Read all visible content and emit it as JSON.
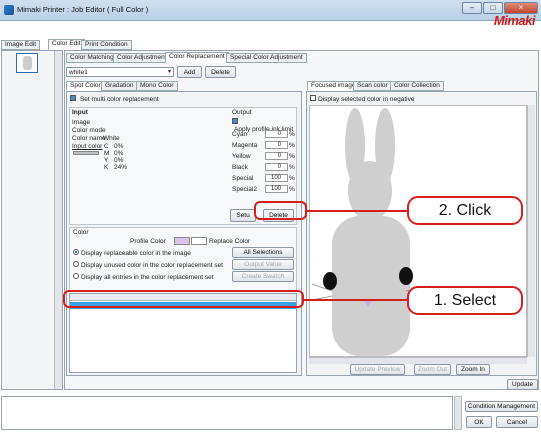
{
  "window": {
    "title": "Mimaki Printer : Job Editor ( Full Color )",
    "logo": "Mimaki",
    "min": "–",
    "max": "□",
    "close": "×"
  },
  "main_tabs": [
    "Image Edit",
    "Color Edit",
    "Print Condition"
  ],
  "color_tabs": [
    "Color Matching",
    "Color Adjustment",
    "Color Replacement",
    "Special Color Adjustment"
  ],
  "preset": {
    "value": "white1",
    "add": "Add",
    "delete": "Delete"
  },
  "sub_tabs": [
    "Spot Color",
    "Gradation",
    "Mono Color"
  ],
  "multi_replace": "Set multi color replacement",
  "input": {
    "heading": "Input",
    "image": "Image",
    "mode": "Color mode",
    "name_label": "Color name",
    "name": "White",
    "input_color": "Input color",
    "cmyk": [
      [
        "C",
        "0%"
      ],
      [
        "M",
        "0%"
      ],
      [
        "Y",
        "0%"
      ],
      [
        "K",
        "24%"
      ]
    ]
  },
  "output": {
    "heading": "Output",
    "apply": "Apply profile ink limit",
    "rows": [
      [
        "Cyan",
        "0"
      ],
      [
        "Magenta",
        "0"
      ],
      [
        "Yellow",
        "0"
      ],
      [
        "Black",
        "0"
      ],
      [
        "Special",
        "100"
      ],
      [
        "Special2",
        "100"
      ]
    ],
    "unit": "%",
    "setup": "Setu",
    "delete": "Delete"
  },
  "color": {
    "heading": "Color",
    "profile": "Profile Color",
    "replace": "Replace Color",
    "opt1": "Display replaceable color in the image",
    "opt2": "Display unused color in the color replacement set",
    "opt3": "Display all entries in the color replacement set",
    "btn1": "All Selections",
    "btn2": "Output Value Acquisition",
    "btn3": "Create Swatch"
  },
  "preview": {
    "tabs": [
      "Focused image",
      "Scan color",
      "Color Collection"
    ],
    "negative": "Display selected color in negative",
    "update_preview": "Update Preview",
    "zoom_out": "Zoom Out",
    "zoom_in": "Zoom In"
  },
  "update": "Update",
  "condition": "Condition Management",
  "ok": "OK",
  "cancel": "Cancel",
  "callouts": {
    "click": "2. Click",
    "select": "1. Select"
  },
  "colors": {
    "accent": "#d51f1f",
    "selected_row": "#3b9ee0",
    "profile_swatch": "#d9c3e6"
  }
}
